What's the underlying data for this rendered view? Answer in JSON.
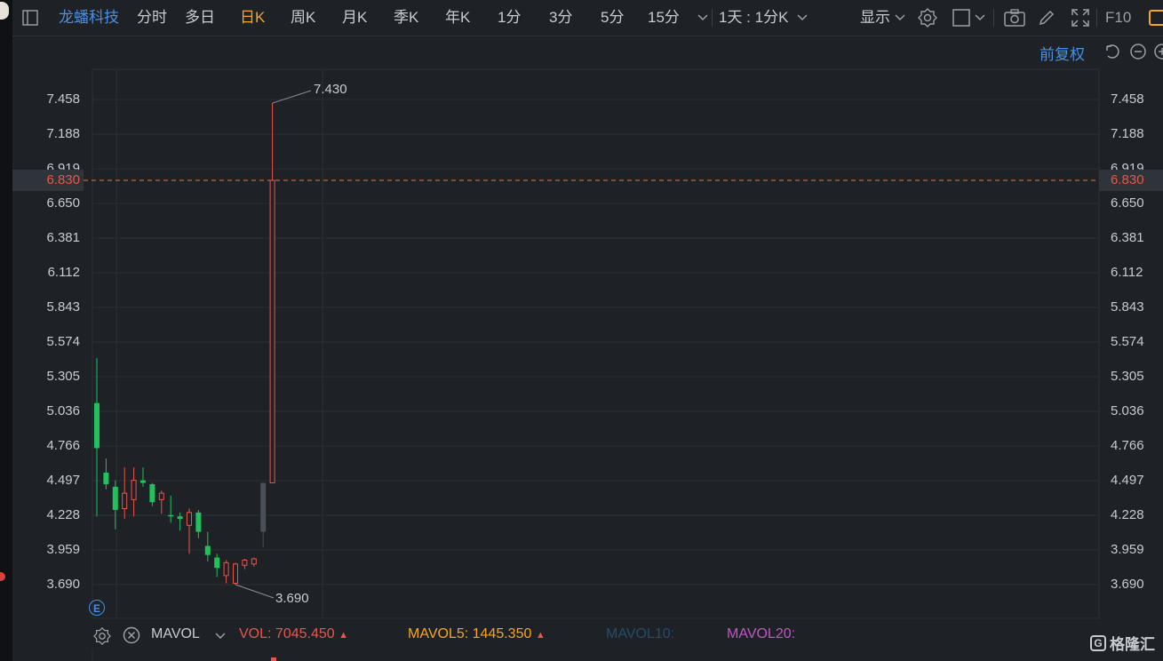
{
  "toolbar": {
    "stock_name": "龙蟠科技",
    "periods": [
      "分时",
      "多日",
      "日K",
      "周K",
      "月K",
      "季K",
      "年K",
      "1分",
      "3分",
      "5分",
      "15分"
    ],
    "active_period": "日K",
    "compare_label": "1天 : 1分K",
    "display_label": "显示",
    "f10_label": "F10",
    "icons": [
      "panel-toggle-icon",
      "chevron-down-icon",
      "gear-icon",
      "square-icon",
      "camera-icon",
      "pencil-icon",
      "fullscreen-icon",
      "orange-box-icon"
    ]
  },
  "controls": {
    "adjust_label": "前复权",
    "icons": [
      "undo-icon",
      "zoom-out-icon",
      "zoom-in-icon"
    ]
  },
  "chart_data": {
    "type": "candlestick",
    "y_ticks": [
      "7.458",
      "7.188",
      "6.919",
      "6.650",
      "6.381",
      "6.112",
      "5.843",
      "5.574",
      "5.305",
      "5.036",
      "4.766",
      "4.497",
      "4.228",
      "3.959",
      "3.690"
    ],
    "ylim": [
      3.69,
      7.458
    ],
    "current_price": "6.830",
    "max_label": "7.430",
    "min_label": "3.690",
    "colors": {
      "up": "#e8564a",
      "down": "#1fc25b",
      "grid": "#2b3035",
      "price_line": "#e8763a"
    },
    "candles": [
      {
        "open": 5.1,
        "close": 4.75,
        "high": 5.45,
        "low": 4.22
      },
      {
        "open": 4.56,
        "close": 4.47,
        "high": 4.67,
        "low": 4.43
      },
      {
        "open": 4.45,
        "close": 4.27,
        "high": 4.5,
        "low": 4.12
      },
      {
        "open": 4.28,
        "close": 4.4,
        "high": 4.6,
        "low": 4.2
      },
      {
        "open": 4.35,
        "close": 4.5,
        "high": 4.6,
        "low": 4.22
      },
      {
        "open": 4.5,
        "close": 4.48,
        "high": 4.6,
        "low": 4.45
      },
      {
        "open": 4.47,
        "close": 4.33,
        "high": 4.48,
        "low": 4.3
      },
      {
        "open": 4.35,
        "close": 4.4,
        "high": 4.42,
        "low": 4.24
      },
      {
        "open": 4.23,
        "close": 4.22,
        "high": 4.38,
        "low": 4.17
      },
      {
        "open": 4.22,
        "close": 4.2,
        "high": 4.25,
        "low": 4.11
      },
      {
        "open": 4.15,
        "close": 4.25,
        "high": 4.28,
        "low": 3.93
      },
      {
        "open": 4.25,
        "close": 4.1,
        "high": 4.27,
        "low": 4.05
      },
      {
        "open": 3.99,
        "close": 3.92,
        "high": 4.1,
        "low": 3.87
      },
      {
        "open": 3.9,
        "close": 3.82,
        "high": 3.93,
        "low": 3.75
      },
      {
        "open": 3.76,
        "close": 3.86,
        "high": 3.88,
        "low": 3.7
      },
      {
        "open": 3.7,
        "close": 3.85,
        "high": 3.86,
        "low": 3.69
      },
      {
        "open": 3.84,
        "close": 3.88,
        "high": 3.89,
        "low": 3.81
      },
      {
        "open": 3.85,
        "close": 3.89,
        "high": 3.9,
        "low": 3.83
      },
      {
        "open": 4.1,
        "close": 4.48,
        "high": 4.48,
        "low": 3.98,
        "color": "#4a5058"
      },
      {
        "open": 4.48,
        "close": 6.83,
        "high": 7.43,
        "low": 4.48
      }
    ]
  },
  "volume": {
    "indicator": "MAVOL",
    "vol_label": "VOL:",
    "vol_value": "7045.450",
    "ma5_label": "MAVOL5:",
    "ma5_value": "1445.350",
    "ma10_label": "MAVOL10:",
    "ma20_label": "MAVOL20:"
  },
  "badge": "E",
  "watermark": "格隆汇"
}
